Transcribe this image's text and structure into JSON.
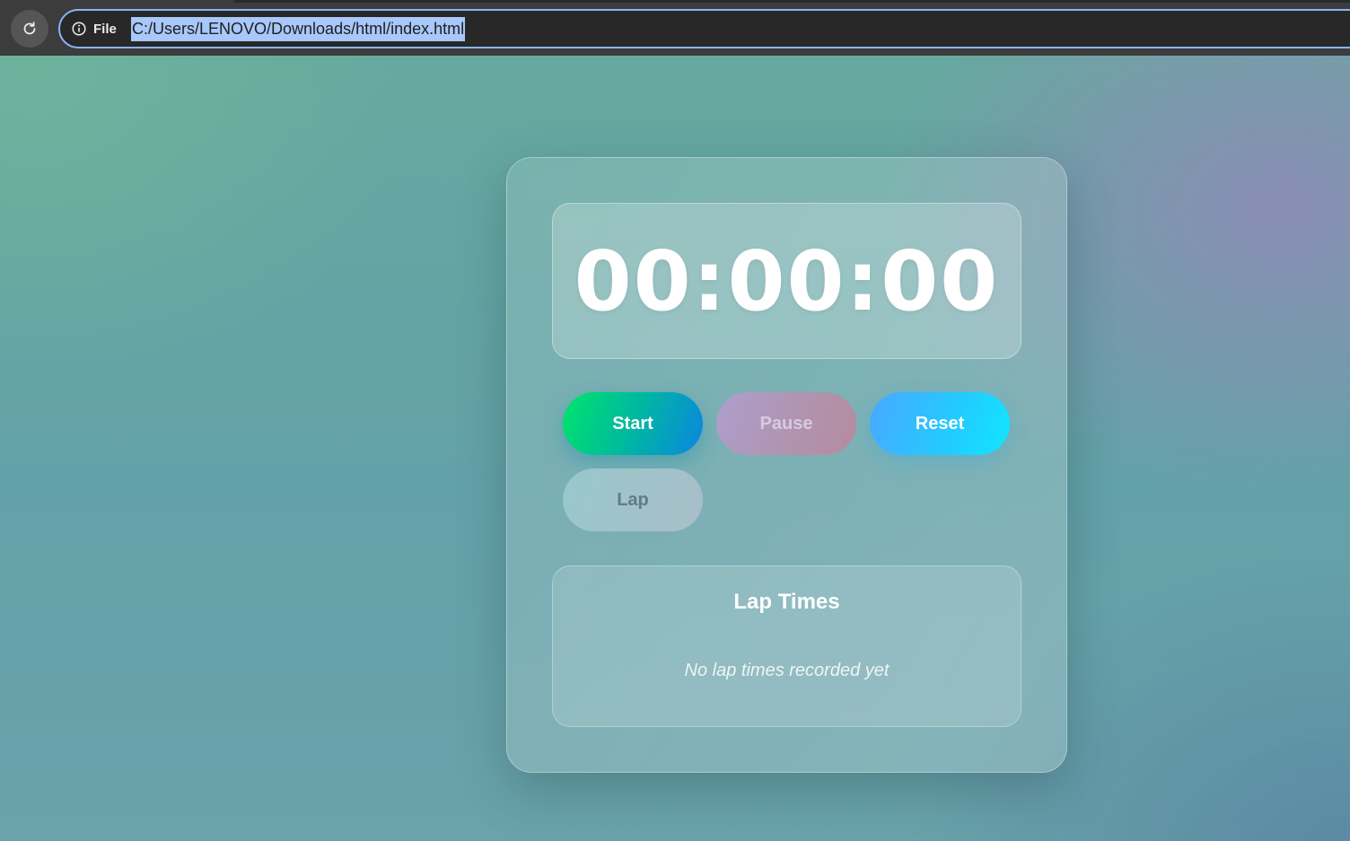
{
  "browser": {
    "reload_icon": "reload-icon",
    "info_icon": "info-icon",
    "scheme_label": "File",
    "url": "C:/Users/LENOVO/Downloads/html/index.html",
    "colors": {
      "chrome": "#3c3c3c",
      "omnibox_border": "#8ab4f8",
      "selection": "#a8c7fa"
    }
  },
  "stopwatch": {
    "time": "00:00:00",
    "buttons": {
      "start": "Start",
      "pause": "Pause",
      "reset": "Reset",
      "lap": "Lap"
    },
    "laps": {
      "title": "Lap Times",
      "empty_message": "No lap times recorded yet"
    },
    "colors": {
      "start_gradient": [
        "#00e46b",
        "#0a86e0"
      ],
      "reset_gradient": [
        "#4aa8ff",
        "#12e6ff"
      ],
      "pause_gradient": [
        "#ad9fcd",
        "#b68b9e"
      ]
    }
  }
}
